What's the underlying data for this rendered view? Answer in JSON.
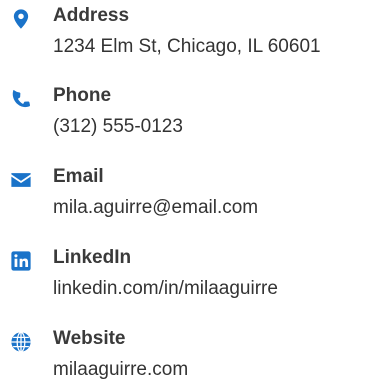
{
  "theme": {
    "icon_color": "#1a73c9",
    "label_color": "#3a3a3a",
    "value_color": "#333333"
  },
  "contacts": [
    {
      "icon": "map-marker-icon",
      "label": "Address",
      "value": "1234 Elm St, Chicago, IL 60601"
    },
    {
      "icon": "phone-icon",
      "label": "Phone",
      "value": "(312) 555-0123"
    },
    {
      "icon": "envelope-icon",
      "label": "Email",
      "value": "mila.aguirre@email.com"
    },
    {
      "icon": "linkedin-icon",
      "label": "LinkedIn",
      "value": "linkedin.com/in/milaaguirre"
    },
    {
      "icon": "globe-icon",
      "label": "Website",
      "value": "milaaguirre.com"
    }
  ]
}
